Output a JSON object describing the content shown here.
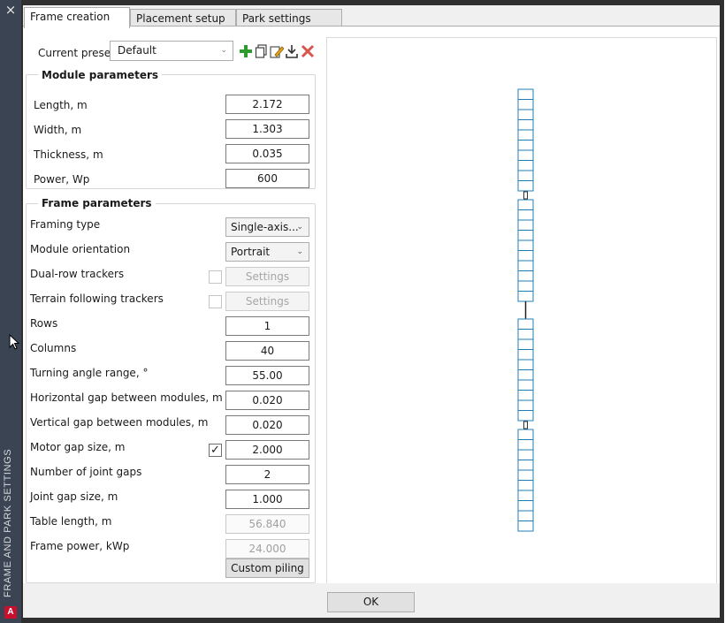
{
  "sidebar": {
    "title": "FRAME AND PARK SETTINGS",
    "close_glyph": "×",
    "logo_letter": "A"
  },
  "tabs": [
    {
      "label": "Frame creation",
      "active": true
    },
    {
      "label": "Placement setup",
      "active": false
    },
    {
      "label": "Park settings",
      "active": false
    }
  ],
  "preset": {
    "label": "Current preset",
    "value": "Default",
    "icons": [
      "add-icon",
      "copy-icon",
      "edit-icon",
      "import-icon",
      "delete-icon"
    ]
  },
  "module": {
    "title": "Module parameters",
    "length_label": "Length, m",
    "length_value": "2.172",
    "width_label": "Width, m",
    "width_value": "1.303",
    "thickness_label": "Thickness, m",
    "thickness_value": "0.035",
    "power_label": "Power, Wp",
    "power_value": "600"
  },
  "frame": {
    "title": "Frame parameters",
    "framing_type_label": "Framing type",
    "framing_type_value": "Single-axis...",
    "orientation_label": "Module orientation",
    "orientation_value": "Portrait",
    "dual_row_label": "Dual-row trackers",
    "dual_row_checked": false,
    "dual_row_settings": "Settings",
    "terrain_label": "Terrain following trackers",
    "terrain_checked": false,
    "terrain_settings": "Settings",
    "rows_label": "Rows",
    "rows_value": "1",
    "columns_label": "Columns",
    "columns_value": "40",
    "turning_label": "Turning angle range, °",
    "turning_value": "55.00",
    "hgap_label": "Horizontal gap between modules, m",
    "hgap_value": "0.020",
    "vgap_label": "Vertical gap between modules, m",
    "vgap_value": "0.020",
    "motor_label": "Motor gap size, m",
    "motor_checked": true,
    "motor_value": "2.000",
    "joint_count_label": "Number of joint gaps",
    "joint_count_value": "2",
    "joint_size_label": "Joint gap size, m",
    "joint_size_value": "1.000",
    "table_length_label": "Table length, m",
    "table_length_value": "56.840",
    "frame_power_label": "Frame power, kWp",
    "frame_power_value": "24.000",
    "custom_piling_label": "Custom piling"
  },
  "footer": {
    "ok_label": "OK"
  },
  "colors": {
    "module_stroke": "#1f7fb5",
    "sidebar_bg": "#3b4453",
    "add_icon": "#2e9b2e",
    "delete_icon": "#d9534f"
  }
}
